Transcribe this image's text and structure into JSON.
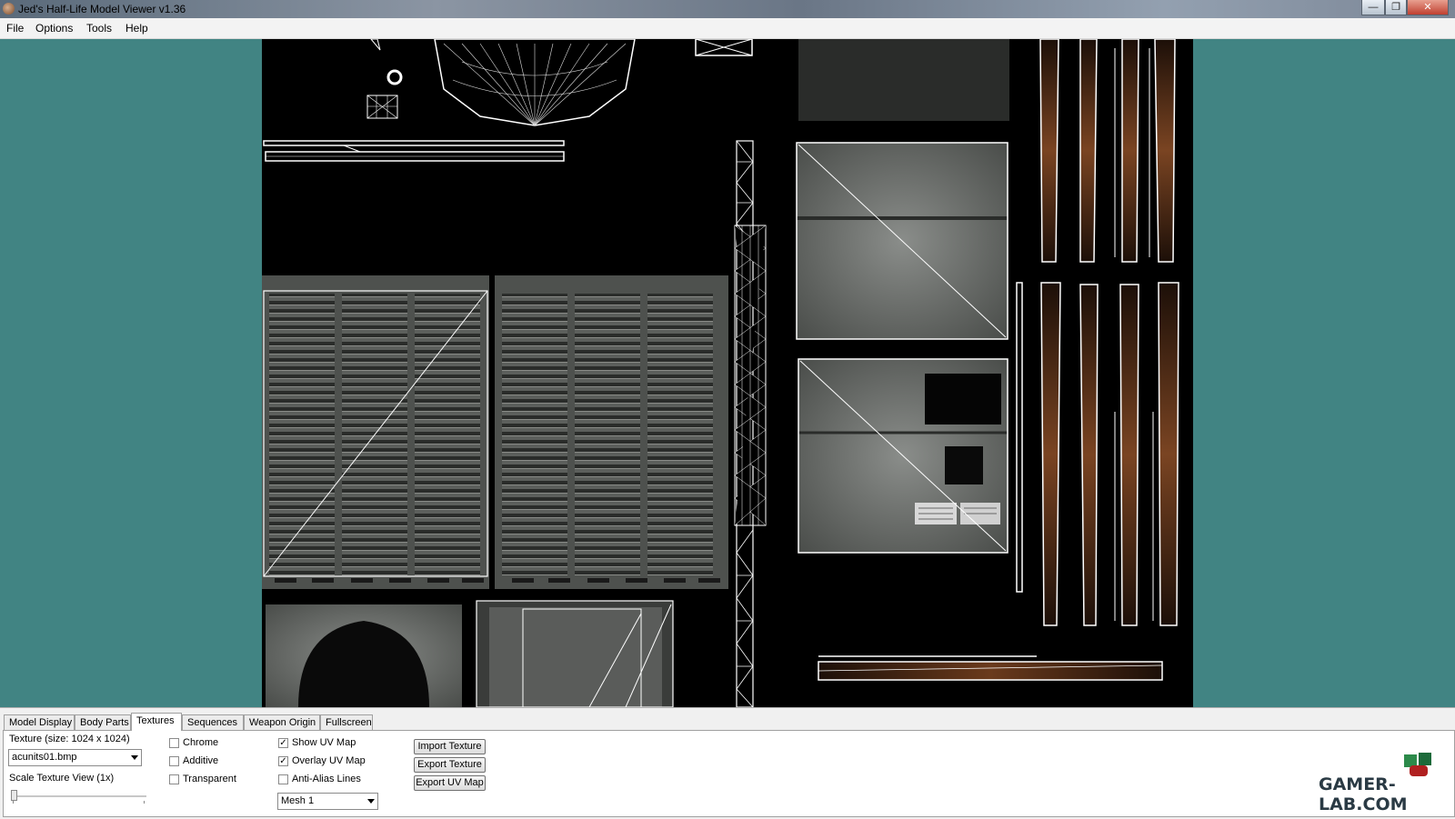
{
  "window": {
    "title": "Jed's Half-Life Model Viewer v1.36",
    "min_icon": "minimize-icon",
    "max_icon": "maximize-icon",
    "close_icon": "close-icon"
  },
  "menu": [
    "File",
    "Options",
    "Tools",
    "Help"
  ],
  "tabs": [
    "Model Display",
    "Body Parts",
    "Textures",
    "Sequences",
    "Weapon Origin",
    "Fullscreen"
  ],
  "active_tab": "Textures",
  "textures_panel": {
    "texture_label": "Texture (size: 1024 x 1024)",
    "texture_value": "acunits01.bmp",
    "scale_label": "Scale Texture View (1x)",
    "scale_value": 1,
    "chrome": "Chrome",
    "additive": "Additive",
    "transparent": "Transparent",
    "show_uv": "Show UV Map",
    "overlay_uv": "Overlay UV Map",
    "antialias": "Anti-Alias Lines",
    "mesh_value": "Mesh 1",
    "import_texture": "Import Texture",
    "export_texture": "Export Texture",
    "export_uv": "Export UV Map",
    "checked": {
      "chrome": false,
      "additive": false,
      "transparent": false,
      "show_uv": true,
      "overlay_uv": true,
      "antialias": false
    }
  },
  "colors": {
    "viewport_bg": "#418483",
    "texture_bg": "#000000",
    "uv_lines": "#ffffff"
  },
  "watermark": "GAMER-LAB.COM"
}
